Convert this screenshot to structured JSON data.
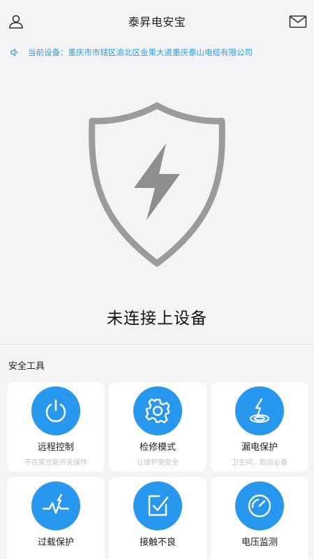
{
  "header": {
    "title": "泰昇电安宝"
  },
  "notice": {
    "text": "当前设备：重庆市市辖区渝北区金果大道重庆泰山电缆有限公司"
  },
  "status": {
    "text": "未连接上设备"
  },
  "tools": {
    "title": "安全工具",
    "items": [
      {
        "label": "远程控制",
        "sub": "不在家也能开关操作",
        "icon": "power-icon"
      },
      {
        "label": "检修模式",
        "sub": "让维护更安全",
        "icon": "gear-icon"
      },
      {
        "label": "漏电保护",
        "sub": "卫生间、厨房必备",
        "icon": "leakage-icon"
      },
      {
        "label": "过载保护",
        "sub": "",
        "icon": "pulse-icon"
      },
      {
        "label": "接触不良",
        "sub": "",
        "icon": "contact-icon"
      },
      {
        "label": "电压监测",
        "sub": "",
        "icon": "gauge-icon"
      }
    ]
  },
  "colors": {
    "accent": "#2897ee",
    "notice_text": "#2c9ff0",
    "shield_gray": "#9b9b9b"
  }
}
